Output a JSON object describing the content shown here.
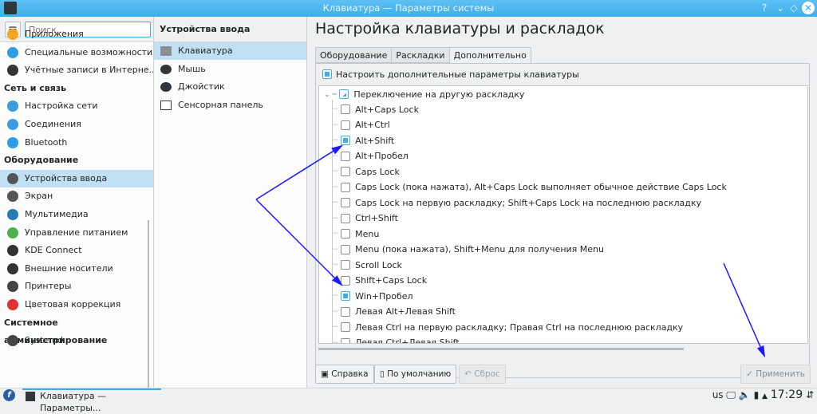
{
  "window": {
    "title": "Клавиатура — Параметры системы",
    "buttons": [
      "?",
      "⌄",
      "◇",
      "✕"
    ]
  },
  "sidebar": {
    "search_placeholder": "Поиск...",
    "items": [
      {
        "label": "Приложения",
        "icon": "star-icon",
        "color": "#f6a623"
      },
      {
        "label": "Специальные возможности",
        "icon": "accessibility-icon",
        "color": "#2e9be6"
      },
      {
        "label": "Учётные записи в Интерне...",
        "icon": "globe-icon",
        "color": "#31363b"
      },
      {
        "heading": "Сеть и связь"
      },
      {
        "label": "Настройка сети",
        "icon": "network-globe-icon",
        "color": "#3d9be0"
      },
      {
        "label": "Соединения",
        "icon": "connections-icon",
        "color": "#3d9be0"
      },
      {
        "label": "Bluetooth",
        "icon": "bluetooth-icon",
        "color": "#2e9be6"
      },
      {
        "heading": "Оборудование"
      },
      {
        "label": "Устройства ввода",
        "icon": "input-devices-icon",
        "color": "#555",
        "selected": true
      },
      {
        "label": "Экран",
        "icon": "display-icon",
        "color": "#555"
      },
      {
        "label": "Мультимедиа",
        "icon": "multimedia-icon",
        "color": "#2a7ab8"
      },
      {
        "label": "Управление питанием",
        "icon": "power-icon",
        "color": "#4caf50"
      },
      {
        "label": "KDE Connect",
        "icon": "phone-icon",
        "color": "#333"
      },
      {
        "label": "Внешние носители",
        "icon": "usb-icon",
        "color": "#333"
      },
      {
        "label": "Принтеры",
        "icon": "printer-icon",
        "color": "#444"
      },
      {
        "label": "Цветовая коррекция",
        "icon": "color-wheel-icon",
        "color": "#d33"
      },
      {
        "heading": "Системное администрирование"
      },
      {
        "label": "Systemd",
        "icon": "systemd-icon",
        "color": "#444"
      }
    ]
  },
  "subnav": {
    "title": "Устройства ввода",
    "items": [
      {
        "label": "Клавиатура",
        "icon": "keyboard-icon",
        "selected": true
      },
      {
        "label": "Мышь",
        "icon": "mouse-icon"
      },
      {
        "label": "Джойстик",
        "icon": "joystick-icon"
      },
      {
        "label": "Сенсорная панель",
        "icon": "touchpad-icon"
      }
    ]
  },
  "main": {
    "title": "Настройка клавиатуры и раскладок",
    "tabs": [
      {
        "label": "Оборудование"
      },
      {
        "label": "Раскладки"
      },
      {
        "label": "Дополнительно",
        "active": true
      }
    ],
    "configure_label": "Настроить дополнительные параметры клавиатуры",
    "configure_checked": true,
    "group": {
      "label": "Переключение на другую раскладку",
      "state": "partial"
    },
    "options": [
      {
        "label": "Alt+Caps Lock",
        "checked": false
      },
      {
        "label": "Alt+Ctrl",
        "checked": false
      },
      {
        "label": "Alt+Shift",
        "checked": true
      },
      {
        "label": "Alt+Пробел",
        "checked": false
      },
      {
        "label": "Caps Lock",
        "checked": false
      },
      {
        "label": "Caps Lock (пока нажата), Alt+Caps Lock выполняет обычное действие Caps Lock",
        "checked": false
      },
      {
        "label": "Caps Lock на первую раскладку; Shift+Caps Lock на последнюю раскладку",
        "checked": false
      },
      {
        "label": "Ctrl+Shift",
        "checked": false
      },
      {
        "label": "Menu",
        "checked": false
      },
      {
        "label": "Menu (пока нажата), Shift+Menu для получения Menu",
        "checked": false
      },
      {
        "label": "Scroll Lock",
        "checked": false
      },
      {
        "label": "Shift+Caps Lock",
        "checked": false
      },
      {
        "label": "Win+Пробел",
        "checked": true
      },
      {
        "label": "Левая Alt+Левая Shift",
        "checked": false
      },
      {
        "label": "Левая Ctrl на первую раскладку; Правая Ctrl на последнюю раскладку",
        "checked": false
      },
      {
        "label": "Левая Ctrl+Левая Shift",
        "checked": false
      }
    ],
    "buttons": {
      "help": "Справка",
      "defaults": "По умолчанию",
      "reset": "Сброс",
      "apply": "Применить"
    }
  },
  "taskbar": {
    "task": "Клавиатура — Параметры...",
    "layout": "us",
    "clock": "17:29"
  },
  "annotation_color": "#1a1aff"
}
